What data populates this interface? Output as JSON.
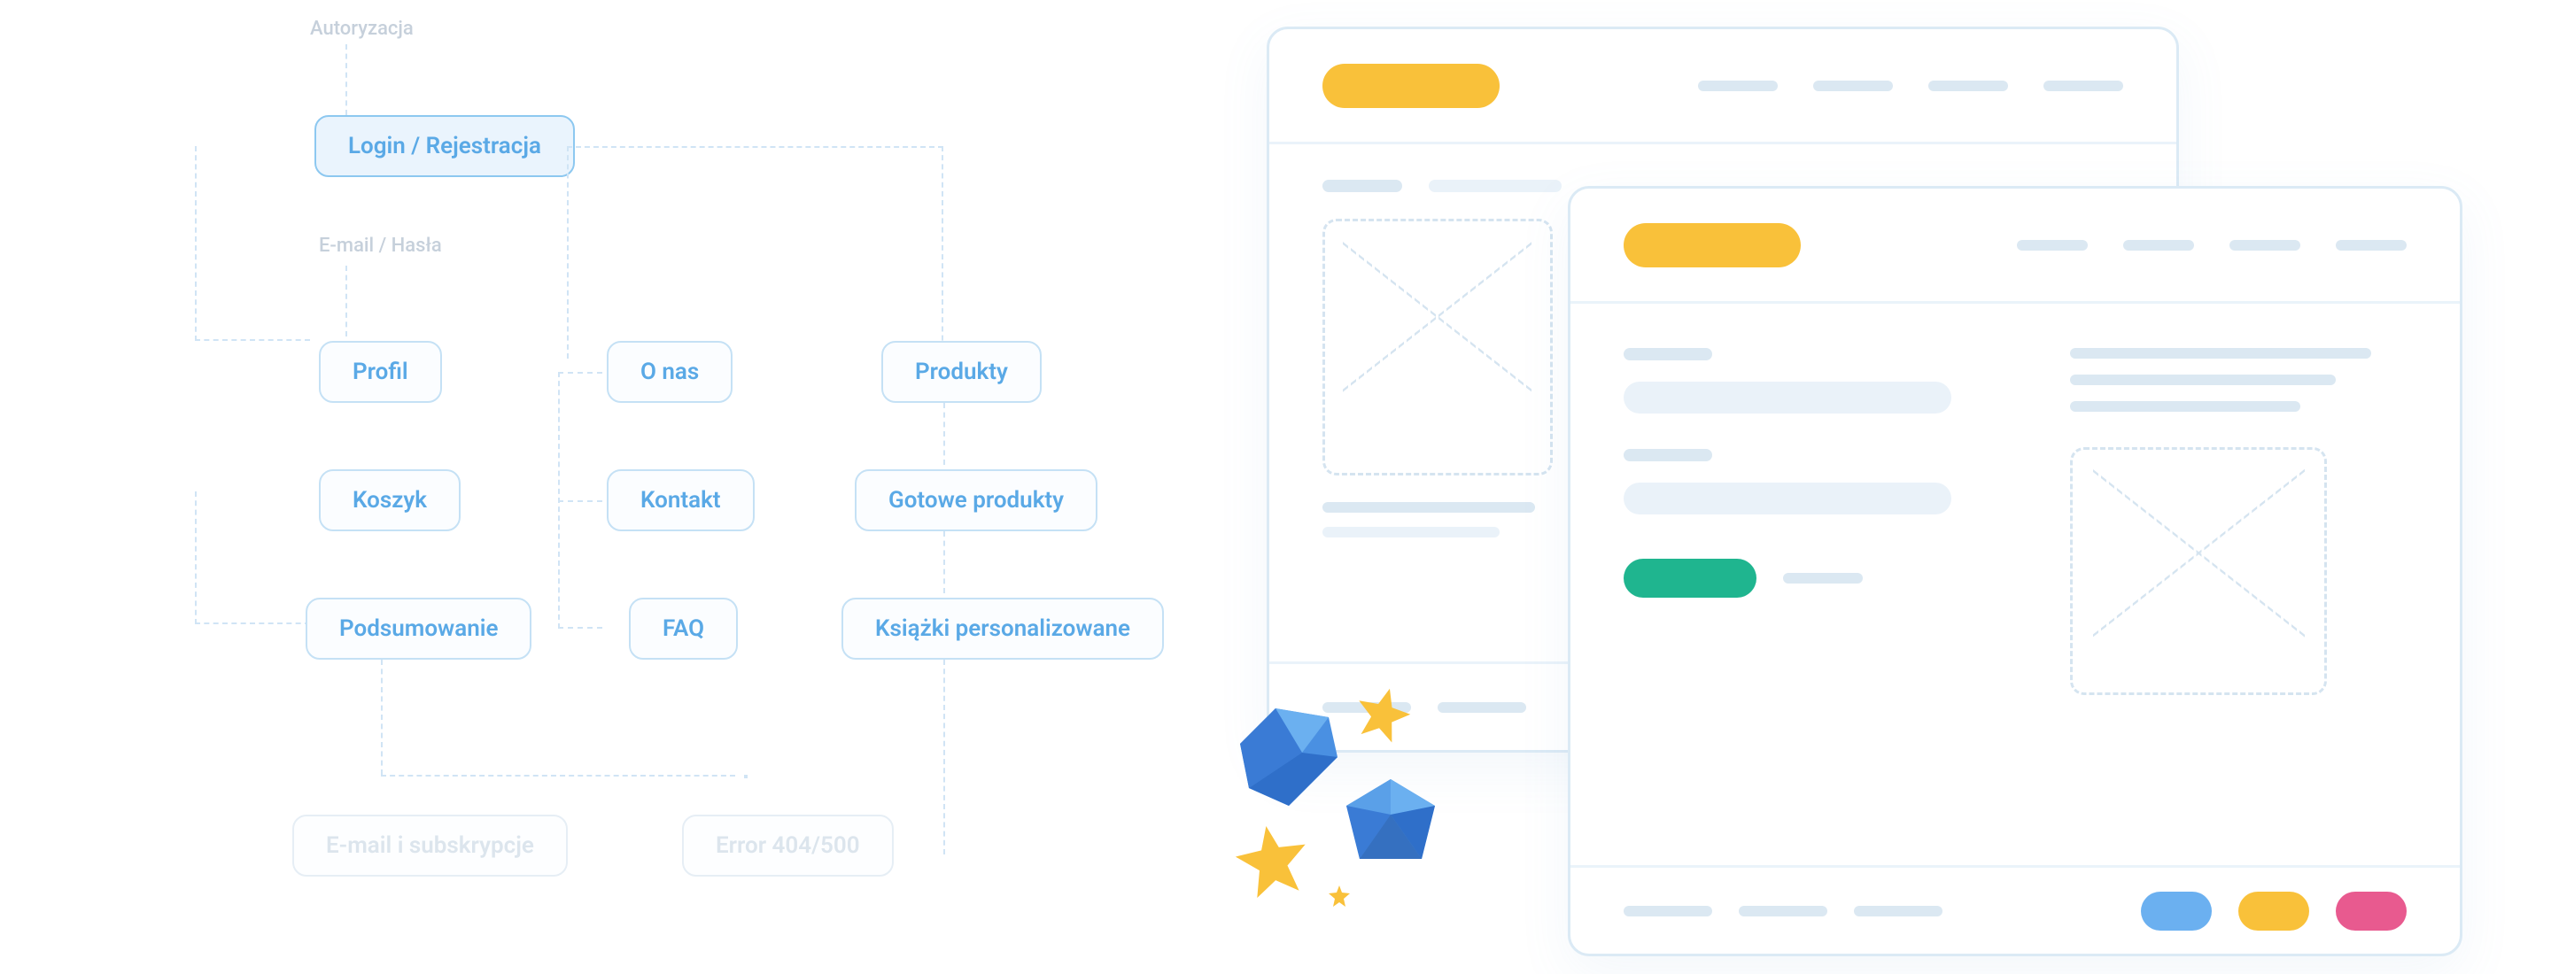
{
  "sitemap": {
    "header_label": "Autoryzacja",
    "sub_label": "E-mail / Hasła",
    "nodes": {
      "login": "Login / Rejestracja",
      "profil": "Profil",
      "onas": "O nas",
      "produkty": "Produkty",
      "koszyk": "Koszyk",
      "kontakt": "Kontakt",
      "gotowe": "Gotowe produkty",
      "podsumowanie": "Podsumowanie",
      "faq": "FAQ",
      "ksiazki": "Książki personalizowane",
      "email_sub": "E-mail i subskrypcje",
      "error": "Error 404/500"
    }
  },
  "mockups": {
    "colors": {
      "yellow": "#f9c13a",
      "green": "#1fb58f",
      "blue": "#6bb0f0",
      "pink": "#e85a8f",
      "bar_light": "#dbe8f2",
      "bar_lighter": "#eaf2f9"
    }
  }
}
